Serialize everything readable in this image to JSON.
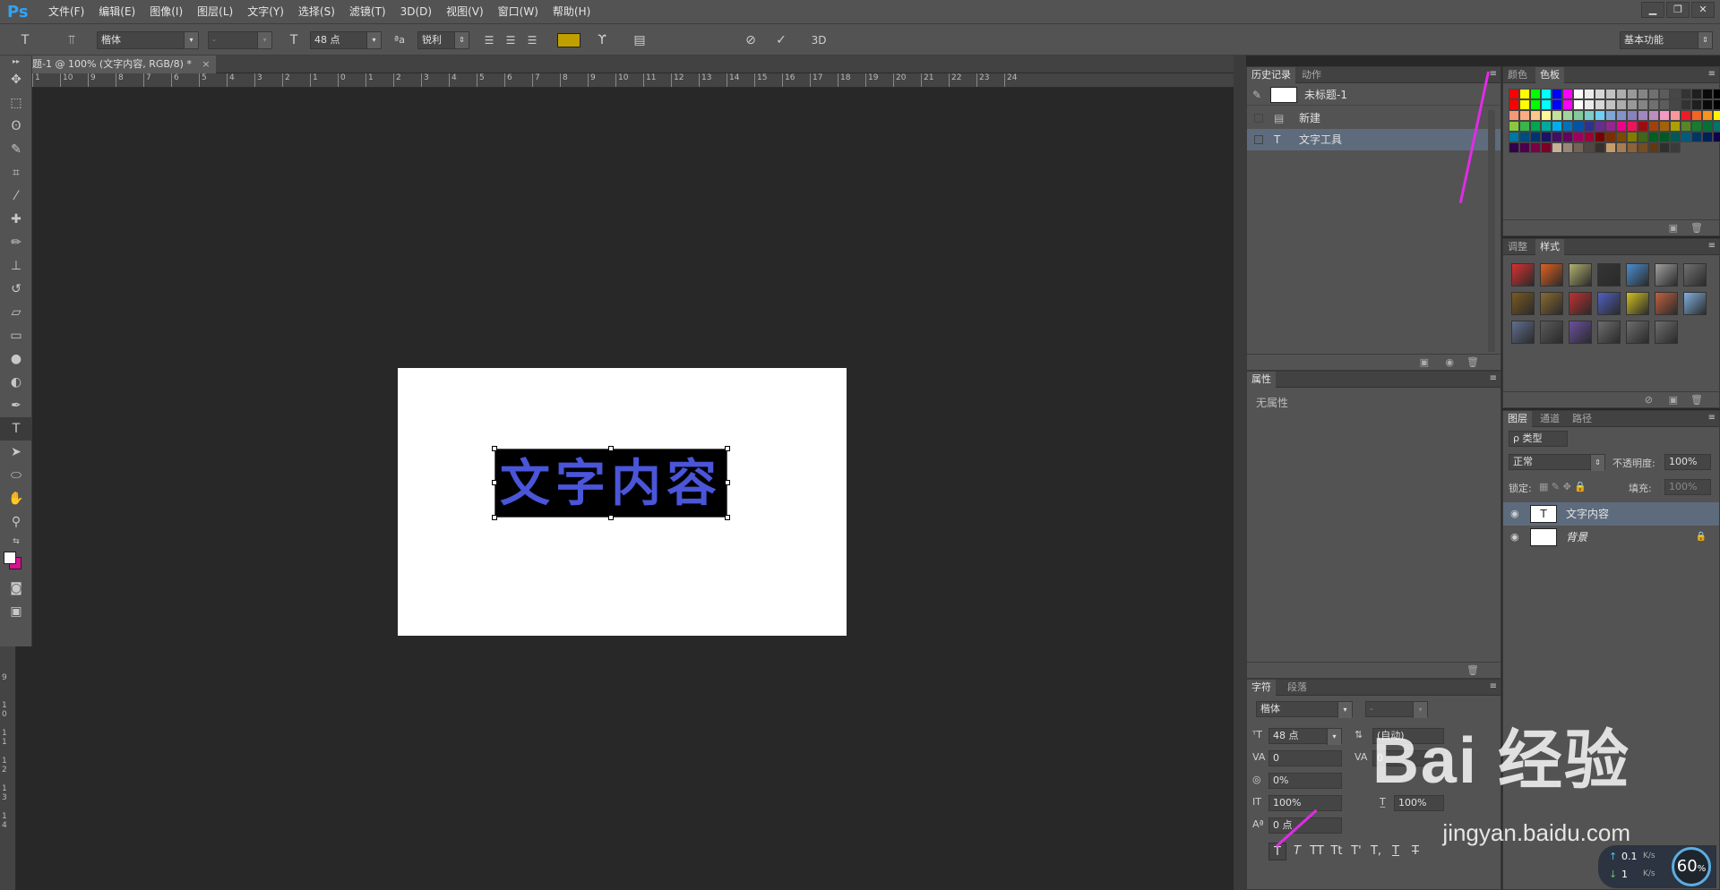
{
  "app": {
    "logo": "Ps"
  },
  "menubar": [
    "文件(F)",
    "编辑(E)",
    "图像(I)",
    "图层(L)",
    "文字(Y)",
    "选择(S)",
    "滤镜(T)",
    "3D(D)",
    "视图(V)",
    "窗口(W)",
    "帮助(H)"
  ],
  "window_controls": [
    "▁",
    "❐",
    "✕"
  ],
  "options": {
    "font_family": "楷体",
    "font_style": "-",
    "font_size": "48 点",
    "aa_label": "ªa",
    "antialias": "锐利",
    "text_color": "#bfa000",
    "threeD": "3D",
    "workspace": "基本功能"
  },
  "document": {
    "tab_title": "题-1 @ 100% (文字内容, RGB/8) *",
    "tab_close": "×",
    "text": "文字内容",
    "text_color": "#4a55d8",
    "ruler_top": [
      "1",
      "10",
      "9",
      "8",
      "7",
      "6",
      "5",
      "4",
      "3",
      "2",
      "1",
      "0",
      "1",
      "2",
      "3",
      "4",
      "5",
      "6",
      "7",
      "8",
      "9",
      "10",
      "11",
      "12",
      "13",
      "14",
      "15",
      "16",
      "17",
      "18",
      "19",
      "20",
      "21",
      "22",
      "23",
      "24"
    ],
    "ruler_left": [
      "9",
      "1 0",
      "1 1",
      "1 2",
      "1 3",
      "1 4"
    ]
  },
  "history_panel": {
    "tabs": [
      "历史记录",
      "动作"
    ],
    "snapshot": "未标题-1",
    "items": [
      "新建",
      "文字工具"
    ]
  },
  "properties_panel": {
    "tabs": [
      "属性"
    ],
    "empty_text": "无属性"
  },
  "color_panel": {
    "tabs": [
      "颜色",
      "色板"
    ],
    "swatches": [
      "#ff0000",
      "#ffff00",
      "#00ff00",
      "#00ffff",
      "#0000ff",
      "#ff00ff",
      "#ffffff",
      "#ebebeb",
      "#d6d6d6",
      "#c2c2c2",
      "#adadad",
      "#999999",
      "#858585",
      "#707070",
      "#5c5c5c",
      "#474747",
      "#333333",
      "#1f1f1f",
      "#0a0a0a",
      "#000000",
      "#ff0000",
      "#ffff00",
      "#00ff00",
      "#00ffff",
      "#0000ff",
      "#ff00ff",
      "#ffffff",
      "#ebebeb",
      "#d6d6d6",
      "#c2c2c2",
      "#adadad",
      "#999999",
      "#858585",
      "#707070",
      "#5c5c5c",
      "#474747",
      "#333333",
      "#1f1f1f",
      "#0a0a0a",
      "#000000",
      "#f7977a",
      "#f9ad81",
      "#fdc68a",
      "#fff79a",
      "#c4df9b",
      "#a2d39c",
      "#82ca9d",
      "#7bcdc8",
      "#6ecff6",
      "#7ea7d8",
      "#8493ca",
      "#8882be",
      "#a187be",
      "#bc8dbf",
      "#f49ac2",
      "#f6989d",
      "#ed1c24",
      "#f26522",
      "#f7941d",
      "#fff200",
      "#8dc73f",
      "#39b54a",
      "#00a651",
      "#00a99d",
      "#00aeef",
      "#0072bc",
      "#0054a6",
      "#2e3192",
      "#662d91",
      "#92278f",
      "#ec008c",
      "#ed145b",
      "#9e0b0f",
      "#a0410d",
      "#a3620a",
      "#aba000",
      "#598527",
      "#1a7b30",
      "#007236",
      "#00746b",
      "#0076a3",
      "#004b80",
      "#003471",
      "#1b1464",
      "#440e62",
      "#630460",
      "#9e005d",
      "#9e0039",
      "#790000",
      "#7b2e00",
      "#7d4900",
      "#827b00",
      "#406618",
      "#005e20",
      "#005826",
      "#005952",
      "#005b7f",
      "#003663",
      "#002157",
      "#0d004c",
      "#32004b",
      "#4b0049",
      "#7b0046",
      "#7a0026",
      "#c7b299",
      "#998675",
      "#736357",
      "#534741",
      "#37302d",
      "#c69c6d",
      "#a67c52",
      "#8c6239",
      "#754c24",
      "#603913",
      "#2f2f2f",
      "#3b3b3b"
    ]
  },
  "adjust_panel": {
    "tabs": [
      "调整",
      "样式"
    ],
    "styles": [
      "#d93030",
      "#e06020",
      "#b0b070",
      "#353535",
      "#4a8fd0",
      "#a0a0a0",
      "#707070",
      "#7a5a20",
      "#8a6a30",
      "#c03030",
      "#5060c0",
      "#d0c020",
      "#c06040",
      "#80b0e0",
      "#607090",
      "#5a5a5a",
      "#6a50a0",
      "#6d6d6d",
      "#6d6d6d",
      "#6d6d6d"
    ]
  },
  "layers_panel": {
    "tabs": [
      "图层",
      "通道",
      "路径"
    ],
    "filter": "ρ 类型",
    "blend_mode": "正常",
    "opacity_label": "不透明度:",
    "opacity": "100%",
    "lock_label": "锁定:",
    "fill_label": "填充:",
    "fill": "100%",
    "layers": [
      {
        "name": "文字内容",
        "thumb": "T",
        "selected": true
      },
      {
        "name": "背景",
        "thumb": "",
        "selected": false,
        "lock": "🔒"
      }
    ]
  },
  "character_panel": {
    "tabs": [
      "字符",
      "段落"
    ],
    "font_family": "楷体",
    "font_style": "-",
    "size": "48 点",
    "leading": "(自动)",
    "kerning": "0",
    "tracking": "0",
    "scale_pct": "0%",
    "vscale": "100%",
    "hscale": "100%",
    "baseline": "0 点",
    "format_buttons": [
      "T",
      "T",
      "TT",
      "Tt",
      "T'",
      "T,",
      "T",
      "T"
    ]
  },
  "watermark": {
    "brand": "Bai 经验",
    "url": "jingyan.baidu.com"
  },
  "net_widget": {
    "up": "0.1",
    "down": "1",
    "unit": "K/s",
    "percent": "60",
    "pct_sign": "%"
  }
}
